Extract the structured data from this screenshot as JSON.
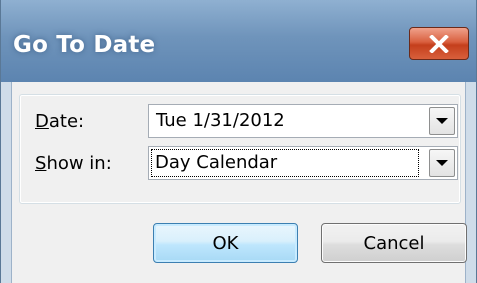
{
  "window": {
    "title": "Go To Date",
    "close_icon": "close-x-icon"
  },
  "form": {
    "date_label": {
      "accel": "D",
      "rest": "ate:"
    },
    "date_value": "Tue 1/31/2012",
    "show_in_label": {
      "accel": "S",
      "rest": "how in:"
    },
    "show_in_value": "Day Calendar",
    "dropdown_icon": "chevron-down-icon"
  },
  "buttons": {
    "ok_label": "OK",
    "cancel_label": "Cancel"
  },
  "colors": {
    "title_bar": "#6f94bb",
    "close_button": "#c43f1c",
    "ok_border": "#3c7fb1",
    "dialog_bg": "#f0f0f0"
  }
}
